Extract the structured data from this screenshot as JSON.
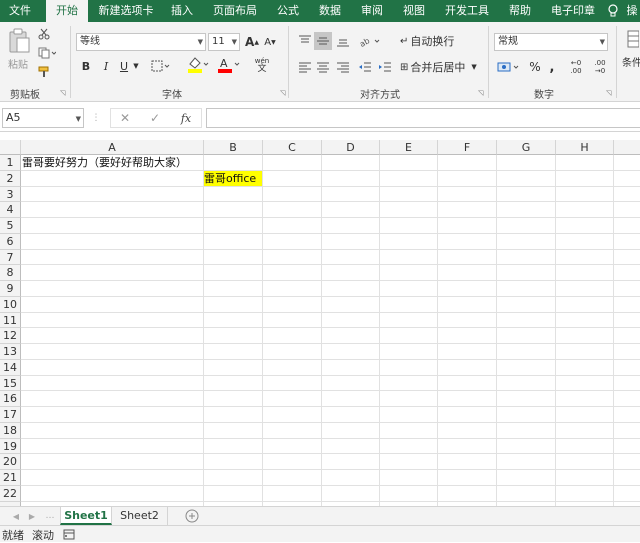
{
  "tabs": [
    "文件",
    "开始",
    "新建选项卡",
    "插入",
    "页面布局",
    "公式",
    "数据",
    "审阅",
    "视图",
    "开发工具",
    "帮助",
    "电子印章",
    "操"
  ],
  "active_tab": "开始",
  "ribbon": {
    "clipboard": {
      "paste_label": "粘贴",
      "group_label": "剪贴板"
    },
    "font": {
      "name": "等线",
      "size": "11",
      "grow": "A",
      "shrink": "A",
      "bold": "B",
      "italic": "I",
      "underline": "U",
      "font_color_glyph": "A",
      "phonetic_glyph": "wén",
      "group_label": "字体",
      "fill_color": "#ffff00",
      "font_color": "#ff0000"
    },
    "alignment": {
      "wrap_label": "自动换行",
      "merge_label": "合并后居中",
      "group_label": "对齐方式"
    },
    "number": {
      "format": "常规",
      "percent": "%",
      "comma": ",",
      "inc_decimal_top": "←0",
      "inc_decimal_bottom": ".00",
      "dec_decimal_top": ".00",
      "dec_decimal_bottom": "→0",
      "group_label": "数字"
    },
    "styles": {
      "cond_label": "条件"
    }
  },
  "formula_bar": {
    "name_box": "A5",
    "cancel": "✕",
    "enter": "✓",
    "fx": "fx",
    "formula": ""
  },
  "columns": [
    "A",
    "B",
    "C",
    "D",
    "E",
    "F",
    "G",
    "H"
  ],
  "rows": [
    "1",
    "2",
    "3",
    "4",
    "5",
    "6",
    "7",
    "8",
    "9",
    "10",
    "11",
    "12",
    "13",
    "14",
    "15",
    "16",
    "17",
    "18",
    "19",
    "20",
    "21",
    "22"
  ],
  "cells": {
    "A1": "雷哥要好努力（要好好帮助大家）",
    "B2": "雷哥office"
  },
  "highlight_color": "#ffff00",
  "sheets": [
    "Sheet1",
    "Sheet2"
  ],
  "active_sheet": "Sheet1",
  "status": {
    "ready": "就绪",
    "scroll": "滚动"
  }
}
